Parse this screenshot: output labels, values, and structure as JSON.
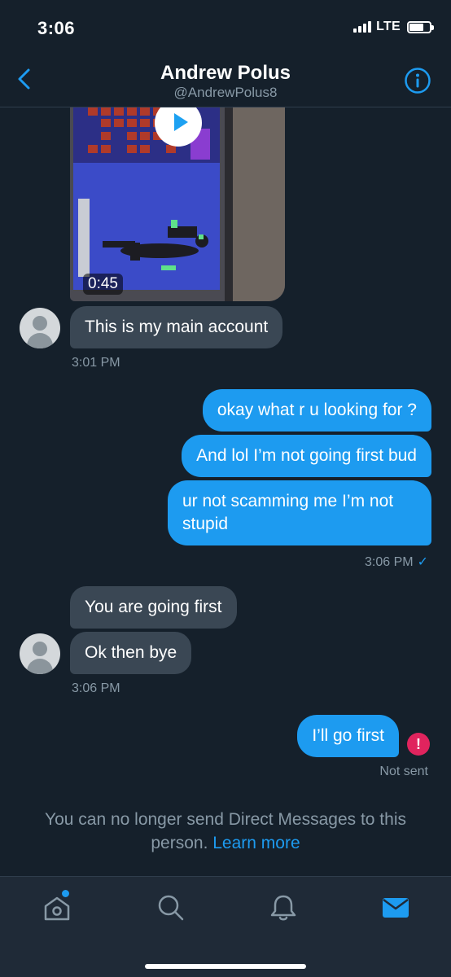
{
  "status_bar": {
    "time": "3:06",
    "network": "LTE",
    "battery_level": 0.7
  },
  "header": {
    "name": "Andrew Polus",
    "handle": "@AndrewPolus8",
    "back_icon": "chevron-left-icon",
    "info_icon": "info-circle-icon"
  },
  "video": {
    "duration": "0:45"
  },
  "messages": [
    {
      "from": "them",
      "text": "This is my main account"
    },
    {
      "from": "them",
      "time": "3:01 PM"
    },
    {
      "from": "me",
      "text": "okay what r u looking for ?"
    },
    {
      "from": "me",
      "text": "And lol I’m not going first bud"
    },
    {
      "from": "me",
      "text": "ur not scamming me I’m not stupid"
    },
    {
      "from": "me",
      "time": "3:06 PM",
      "status_icon": "check-icon",
      "check": "✓"
    },
    {
      "from": "them",
      "text": "You are going first"
    },
    {
      "from": "them",
      "text": "Ok then bye"
    },
    {
      "from": "them",
      "time": "3:06 PM"
    },
    {
      "from": "me",
      "text": "I’ll go first",
      "alert": "!"
    },
    {
      "from": "me",
      "status": "Not sent"
    }
  ],
  "notice": {
    "text": "You can no longer send Direct Messages to this person.",
    "link": "Learn more"
  },
  "tabs": [
    "home-icon",
    "search-icon",
    "bell-icon",
    "mail-icon"
  ],
  "colors": {
    "background": "#15202b",
    "incoming_bubble": "#3a4754",
    "outgoing_bubble": "#1d9bf0",
    "accent": "#1d9bf0",
    "secondary_text": "#8899a6",
    "error": "#e0245e",
    "tabbar": "#1f2a37"
  }
}
